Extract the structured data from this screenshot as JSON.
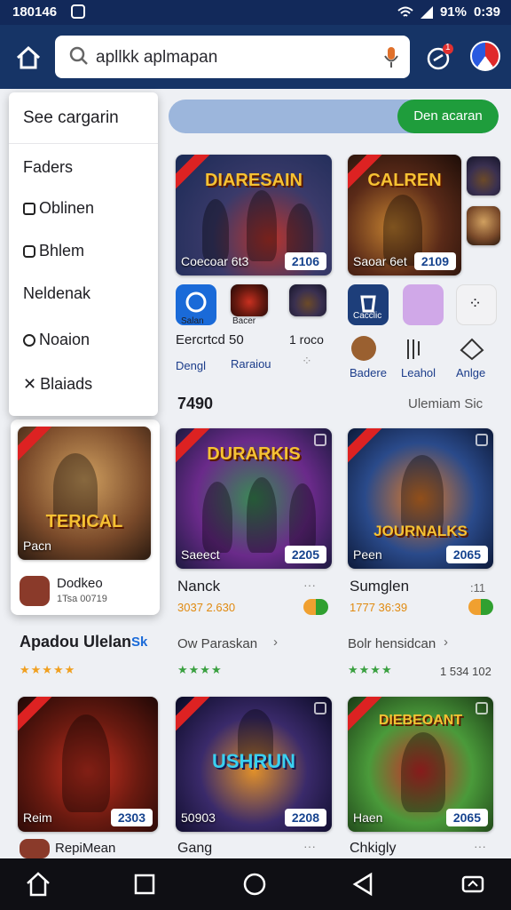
{
  "status": {
    "time": "180146",
    "battery": "91%",
    "clock": "0:39"
  },
  "search": {
    "query": "apllkk aplmapan",
    "notif_count": "1"
  },
  "menu": {
    "header": "See cargarin",
    "items": [
      "Faders",
      "Oblinen",
      "Bhlem",
      "Neldenak",
      "Noaion",
      "Blaiads"
    ]
  },
  "banner": {
    "button": "Den acaran"
  },
  "top_cards": [
    {
      "title": "DIARESAIN",
      "label": "Coecoar 6t3",
      "num": "2106"
    },
    {
      "title": "CALREN",
      "label": "Saoar 6et",
      "num": "2109"
    }
  ],
  "app_row": [
    {
      "name": "Salan"
    },
    {
      "name": "Bacer"
    },
    {
      "name": "Cacclic"
    }
  ],
  "section": {
    "count": "7490",
    "link": "Ulemiam Sic"
  },
  "mid": {
    "left_name": "Eercrtcd 50",
    "left_sub": "Dengl",
    "left_val": "1 roco",
    "right_val": "Raraiou",
    "right_labels": [
      "Badere",
      "Leahol",
      "Anlge"
    ]
  },
  "menu_card": {
    "title": "TERICAL",
    "label": "Pacn",
    "name": "Dodkeo",
    "meta": "1Tsa 00719"
  },
  "row2": [
    {
      "title": "DURARKIS",
      "label": "Saeect",
      "num": "2205",
      "name": "Nanck",
      "meta": "3037 2.630"
    },
    {
      "title": "JOURNALKS",
      "label": "Peen",
      "num": "2065",
      "name": "Sumglen",
      "meta": "1777 36:39",
      "extra": ":11"
    }
  ],
  "row2b": {
    "left_title": "Apadou Ulelan",
    "left_badge": "Sk",
    "mid": "Ow Paraskan",
    "right": "Bolr hensidcan",
    "right_meta": "1 534 102"
  },
  "row3": [
    {
      "label": "Reim",
      "num": "2303",
      "name": "RepiMean"
    },
    {
      "title": "USHRUN",
      "label": "50903",
      "num": "2208",
      "name": "Gang"
    },
    {
      "title": "DIEBEOANT",
      "label": "Haen",
      "num": "2065",
      "name": "Chkigly"
    }
  ]
}
